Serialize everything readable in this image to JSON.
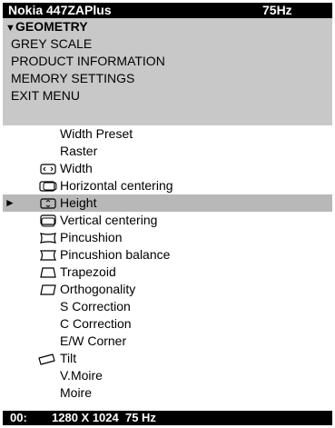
{
  "header": {
    "model": "Nokia 447ZAPlus",
    "frequency": "75Hz"
  },
  "main_menu": [
    {
      "label": "GEOMETRY",
      "active": true
    },
    {
      "label": "GREY SCALE"
    },
    {
      "label": "PRODUCT INFORMATION"
    },
    {
      "label": "MEMORY SETTINGS"
    },
    {
      "label": "EXIT MENU"
    }
  ],
  "submenu": [
    {
      "label": "Width Preset",
      "icon": ""
    },
    {
      "label": "Raster",
      "icon": ""
    },
    {
      "label": "Width",
      "icon": "width-icon"
    },
    {
      "label": "Horizontal centering",
      "icon": "horizontal-centering-icon"
    },
    {
      "label": "Height",
      "icon": "height-icon",
      "selected": true
    },
    {
      "label": "Vertical centering",
      "icon": "vertical-centering-icon"
    },
    {
      "label": "Pincushion",
      "icon": "pincushion-icon"
    },
    {
      "label": "Pincushion balance",
      "icon": "pincushion-balance-icon"
    },
    {
      "label": "Trapezoid",
      "icon": "trapezoid-icon"
    },
    {
      "label": "Orthogonality",
      "icon": "orthogonality-icon"
    },
    {
      "label": "S Correction",
      "icon": ""
    },
    {
      "label": "C Correction",
      "icon": ""
    },
    {
      "label": "E/W Corner",
      "icon": ""
    },
    {
      "label": "Tilt",
      "icon": "tilt-icon"
    },
    {
      "label": "V.Moire",
      "icon": ""
    },
    {
      "label": "Moire",
      "icon": ""
    }
  ],
  "status": {
    "mode": "00:",
    "resolution": "1280 X 1024  75 Hz"
  },
  "colors": {
    "header_bg": "#000000",
    "menu_bg": "#c8c8c8",
    "selected_row_bg": "#b8b8b8"
  }
}
